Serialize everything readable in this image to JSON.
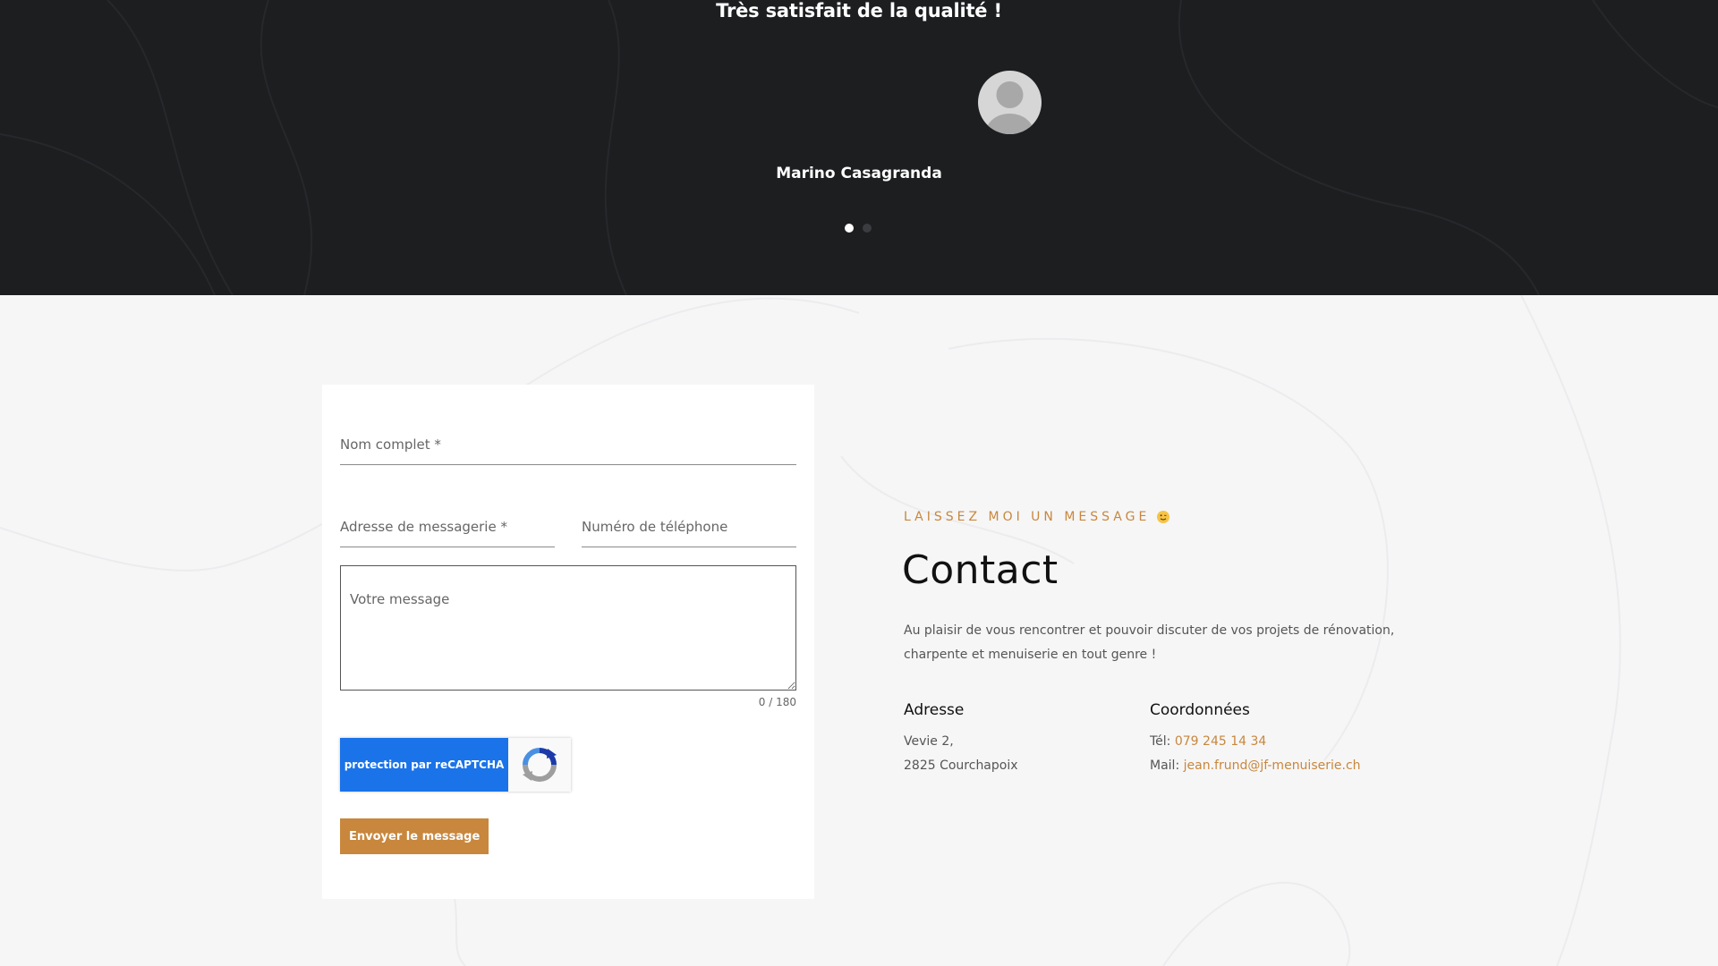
{
  "testimonial": {
    "quote": "Très satisfait de la qualité !",
    "author": "Marino Casagranda",
    "slides": [
      {
        "active": true
      },
      {
        "active": false
      }
    ]
  },
  "form": {
    "name_placeholder": "Nom complet *",
    "email_placeholder": "Adresse de messagerie *",
    "phone_placeholder": "Numéro de téléphone",
    "message_placeholder": "Votre message",
    "counter": "0 / 180",
    "recaptcha_label": "protection par reCAPTCHA",
    "submit_label": "Envoyer le message"
  },
  "contact": {
    "eyebrow": "Laissez moi un message",
    "eyebrow_icon": "wink-emoji-icon",
    "title": "Contact",
    "description": "Au plaisir de vous rencontrer et pouvoir discuter de vos projets de rénovation, charpente et menuiserie en tout genre !",
    "address": {
      "title": "Adresse",
      "line1": "Vevie 2,",
      "line2": "2825 Courchapoix"
    },
    "coords": {
      "title": "Coordonnées",
      "tel_label": "Tél:",
      "tel_value": "079 245 14 34",
      "mail_label": "Mail:",
      "mail_value": "jean.frund@jf-menuiserie.ch"
    }
  },
  "colors": {
    "accent": "#c8873c",
    "dark_bg": "#1c1e20",
    "light_bg": "#f6f6f7",
    "recaptcha_blue": "#1a73e8"
  }
}
